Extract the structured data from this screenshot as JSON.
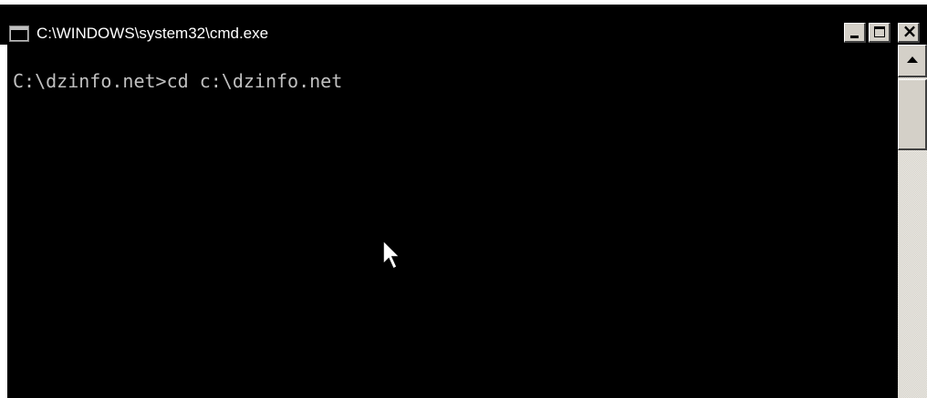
{
  "window": {
    "title": "C:\\WINDOWS\\system32\\cmd.exe",
    "icon": "command-prompt-icon",
    "buttons": {
      "minimize_icon": "minimize-icon",
      "maximize_icon": "maximize-icon",
      "close_icon": "close-icon",
      "close_glyph": "×"
    }
  },
  "console": {
    "lines": [
      "C:\\dzinfo.net>cd c:\\dzinfo.net"
    ],
    "background": "#000000",
    "text_color": "#c0c0c0"
  },
  "scrollbar": {
    "up_icon": "scroll-up-arrow-icon"
  },
  "cursor": {
    "icon": "mouse-pointer-icon"
  }
}
